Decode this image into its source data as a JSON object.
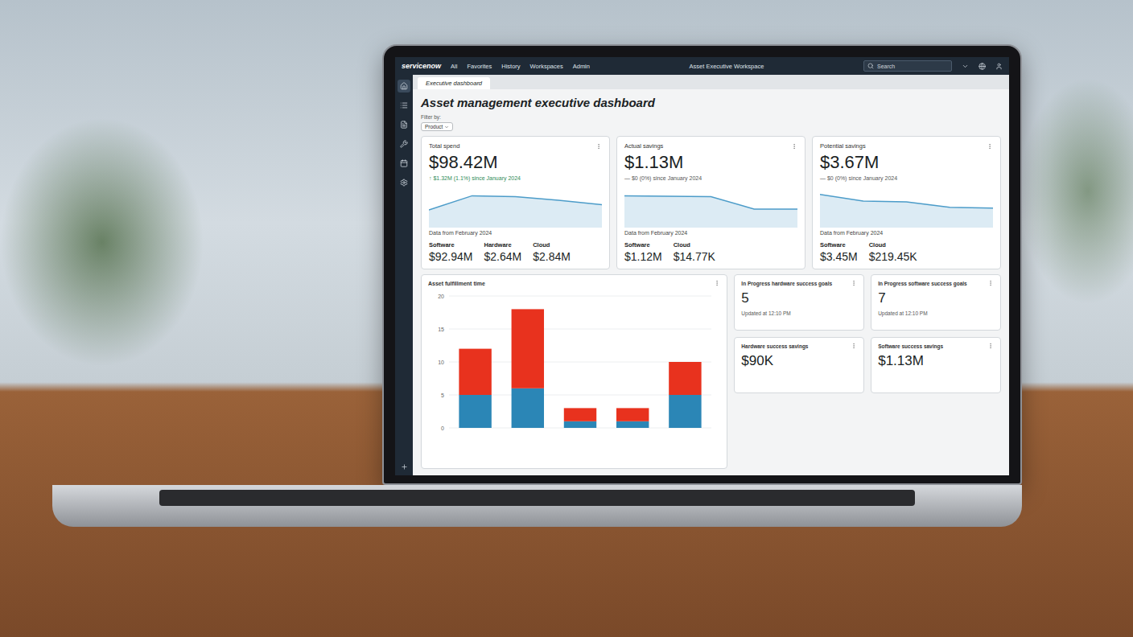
{
  "window": {
    "title": "Asset Executive Workspace"
  },
  "nav": {
    "logo": "servicenow",
    "items": [
      "All",
      "Favorites",
      "History",
      "Workspaces",
      "Admin"
    ],
    "search": {
      "placeholder": "Search"
    }
  },
  "sidebar": {
    "items": [
      {
        "selected": true
      },
      {
        "selected": false
      },
      {
        "selected": false
      },
      {
        "selected": false
      },
      {
        "selected": false
      },
      {
        "selected": false
      }
    ]
  },
  "tabs": [
    {
      "label": "Executive dashboard",
      "selected": true
    }
  ],
  "page": {
    "title": "Asset management executive dashboard",
    "filter": {
      "label": "Filter by:",
      "chip": "Product"
    }
  },
  "summary_cards": [
    {
      "title": "Total spend",
      "value": "$98.42M",
      "delta": "↑ $1.32M (1.1%) since January 2024",
      "trend": "up",
      "series": [
        40,
        72,
        70,
        62,
        52
      ],
      "note": "Data from February 2024",
      "breakdown": [
        {
          "label": "Software",
          "value": "$92.94M"
        },
        {
          "label": "Hardware",
          "value": "$2.64M"
        },
        {
          "label": "Cloud",
          "value": "$2.84M"
        }
      ]
    },
    {
      "title": "Actual savings",
      "value": "$1.13M",
      "delta": "— $0 (0%) since January 2024",
      "trend": "flat",
      "series": [
        72,
        71,
        70,
        42,
        42
      ],
      "note": "Data from February 2024",
      "breakdown": [
        {
          "label": "Software",
          "value": "$1.12M"
        },
        {
          "label": "Cloud",
          "value": "$14.77K"
        }
      ]
    },
    {
      "title": "Potential savings",
      "value": "$3.67M",
      "delta": "— $0 (0%) since January 2024",
      "trend": "flat",
      "series": [
        75,
        60,
        58,
        46,
        44
      ],
      "note": "Data from February 2024",
      "breakdown": [
        {
          "label": "Software",
          "value": "$3.45M"
        },
        {
          "label": "Cloud",
          "value": "$219.45K"
        }
      ]
    }
  ],
  "fulfillment_chart": {
    "title": "Asset fulfillment time",
    "ticks": [
      "20",
      "15",
      "10",
      "5",
      "0"
    ],
    "max": 20,
    "series": [
      {
        "name": "blue",
        "color": "#2b86b6",
        "values": [
          5,
          6,
          1,
          1,
          5
        ]
      },
      {
        "name": "red",
        "color": "#e8321e",
        "values": [
          7,
          12,
          2,
          2,
          5
        ]
      }
    ]
  },
  "kpi_cards": [
    {
      "title": "In Progress hardware success goals",
      "value": "5",
      "updated": "Updated at 12:10 PM"
    },
    {
      "title": "In Progress software success goals",
      "value": "7",
      "updated": "Updated at 12:10 PM"
    },
    {
      "title": "Hardware success savings",
      "value": "$90K",
      "updated": ""
    },
    {
      "title": "Software success savings",
      "value": "$1.13M",
      "updated": ""
    }
  ]
}
